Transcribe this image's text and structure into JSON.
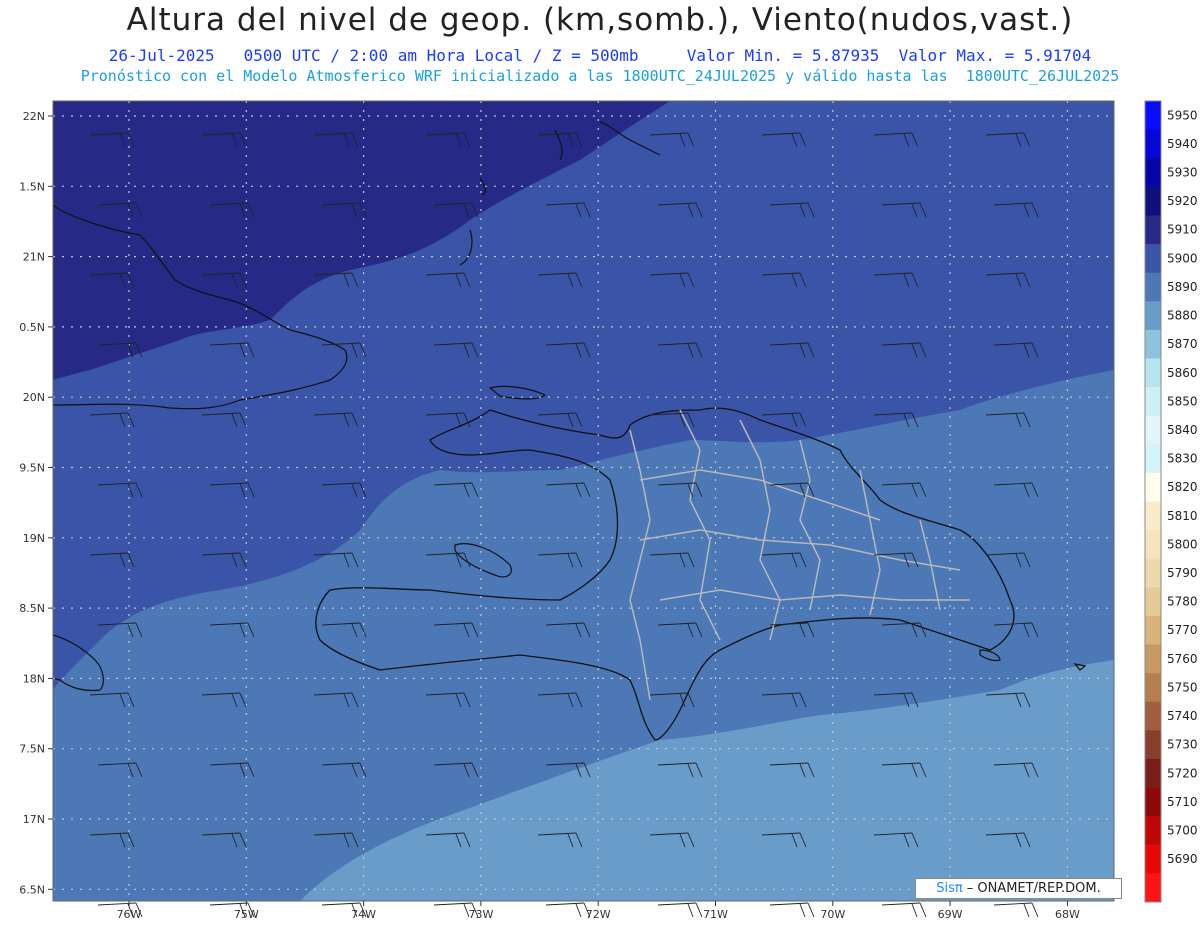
{
  "header": {
    "title": "Altura del nivel de geop. (km,somb.), Viento(nudos,vast.)",
    "date": "26-Jul-2025",
    "time_info": "0500 UTC / 2:00 am Hora Local / Z = 500mb",
    "min_value": "Valor Min. = 5.87935",
    "max_value": "Valor Max. = 5.91704",
    "model_info": "Pronóstico con el Modelo Atmosferico WRF inicializado a las 1800UTC_24JUL2025 y válido hasta las  1800UTC_26JUL2025"
  },
  "axes": {
    "lat_labels": [
      "22N",
      "1.5N",
      "21N",
      "0.5N",
      "20N",
      "9.5N",
      "19N",
      "8.5N",
      "18N",
      "7.5N",
      "17N",
      "6.5N"
    ],
    "lon_labels": [
      "76W",
      "75W",
      "74W",
      "73W",
      "72W",
      "71W",
      "70W",
      "69W",
      "68W"
    ]
  },
  "colorbar": {
    "labels": [
      "5950",
      "5940",
      "5930",
      "5920",
      "5910",
      "5900",
      "5890",
      "5880",
      "5870",
      "5860",
      "5850",
      "5840",
      "5830",
      "5820",
      "5810",
      "5800",
      "5790",
      "5780",
      "5770",
      "5760",
      "5750",
      "5740",
      "5730",
      "5720",
      "5710",
      "5700",
      "5690"
    ],
    "colors": [
      "#0a0aff",
      "#0606d8",
      "#0505a8",
      "#10107a",
      "#262a86",
      "#3a54a8",
      "#4c78b6",
      "#6a9cc9",
      "#8fc2df",
      "#b6e4f0",
      "#cdeff6",
      "#e2f6fa",
      "#d4f3fa",
      "#fffcea",
      "#f8eccb",
      "#f3e4bd",
      "#ecd9ad",
      "#e5cb96",
      "#d8b37a",
      "#c89862",
      "#b57e4e",
      "#a05e3e",
      "#8a3e2c",
      "#7a1e1c",
      "#8e0a0a",
      "#c00606",
      "#e80808",
      "#ff1414"
    ]
  },
  "map_colors": {
    "dark": "#262a86",
    "mid": "#3a54a8",
    "light": "#4c78b6",
    "lighter": "#6a9cc9",
    "coast": "#111111",
    "province": "#b8b8b8",
    "grid": "#c8c8c8"
  },
  "credit": {
    "brand": "Sisπ",
    "text": "– ONAMET/REP.DOM."
  }
}
